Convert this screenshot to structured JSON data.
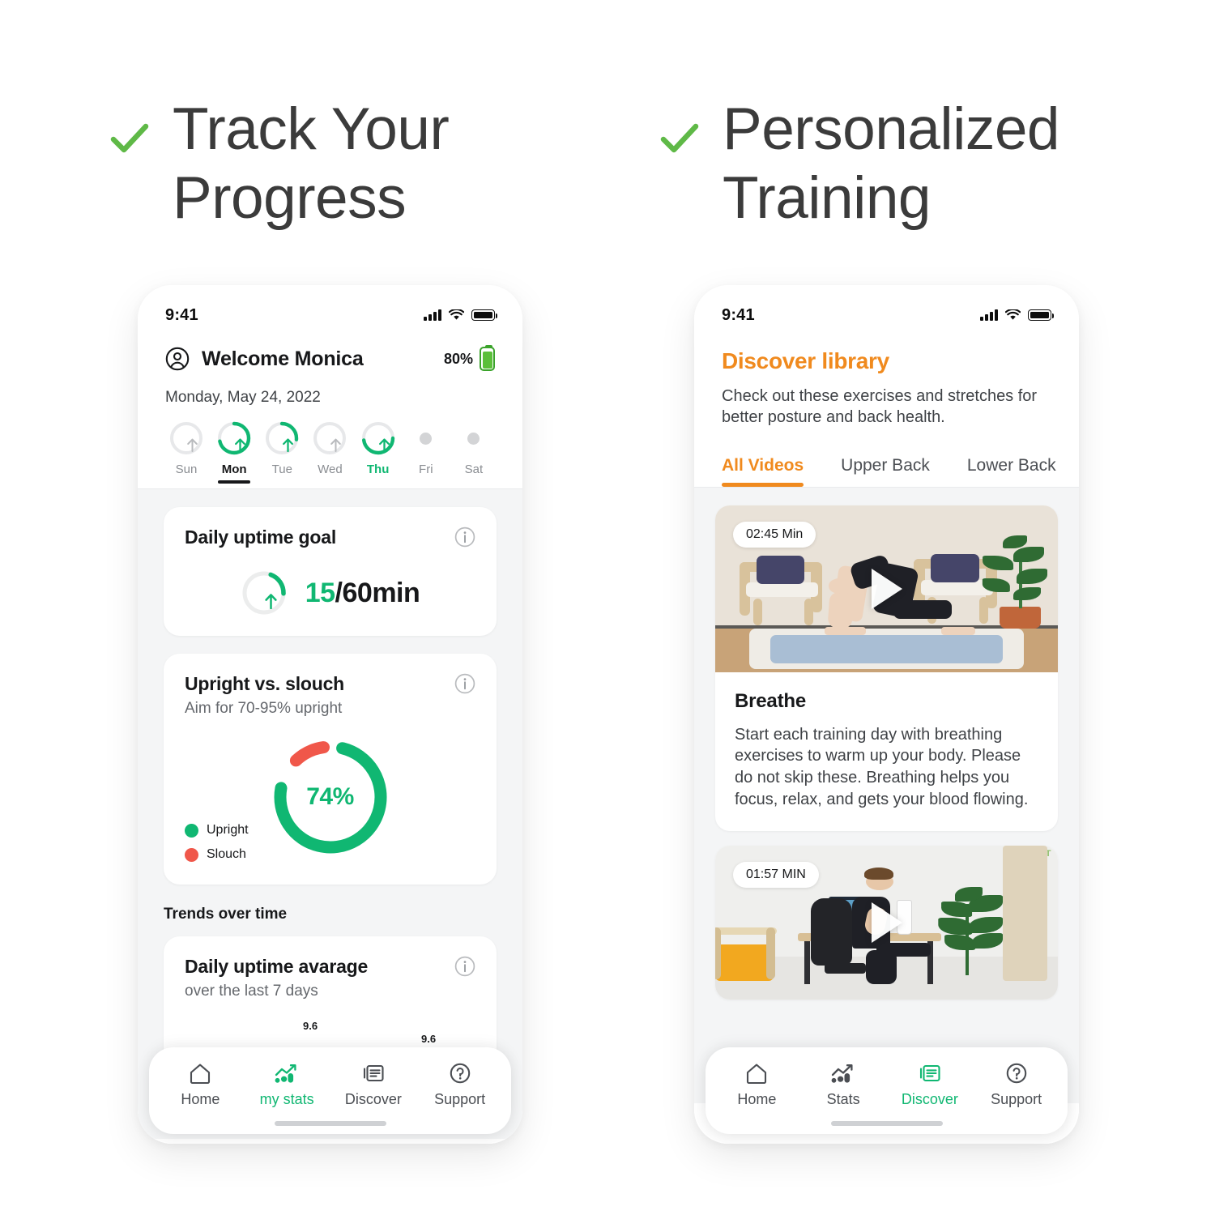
{
  "features": [
    {
      "id": "track-progress",
      "line1": "Track Your",
      "line2": "Progress",
      "check": "check-icon"
    },
    {
      "id": "personalized-training",
      "line1": "Personalized",
      "line2": "Training",
      "check": "check-icon"
    }
  ],
  "colors": {
    "green": "#10b772",
    "green_check": "#5fb947",
    "orange": "#f08a1e",
    "red": "#f0574a",
    "yellow": "#f2b53c",
    "text_dark": "#17181a",
    "text_muted": "#65686d",
    "screen_bg": "#f4f5f6"
  },
  "left_phone": {
    "status": {
      "time": "9:41",
      "signal_icon": "cellular-signal-icon",
      "wifi_icon": "wifi-icon",
      "battery_icon": "battery-icon"
    },
    "header": {
      "avatar_icon": "account-circle-icon",
      "welcome": "Welcome Monica",
      "battery_percent": "80%",
      "battery_icon": "battery-green-icon",
      "date": "Monday, May 24, 2022"
    },
    "week": [
      {
        "label": "Sun",
        "progress": 0,
        "state": "empty",
        "arrow": "grey"
      },
      {
        "label": "Mon",
        "progress": 72,
        "state": "active",
        "arrow": "green"
      },
      {
        "label": "Tue",
        "progress": 27,
        "state": "normal",
        "arrow": "green"
      },
      {
        "label": "Wed",
        "progress": 0,
        "state": "empty",
        "arrow": "grey"
      },
      {
        "label": "Thu",
        "progress": 48,
        "state": "highlight",
        "arrow": "green"
      },
      {
        "label": "Fri",
        "progress": 0,
        "state": "dot",
        "arrow": "none"
      },
      {
        "label": "Sat",
        "progress": 0,
        "state": "dot",
        "arrow": "none"
      }
    ],
    "goal_card": {
      "title": "Daily uptime goal",
      "info_icon": "info-icon",
      "arrow_icon": "arrow-up-icon",
      "value": "15",
      "separator": "/",
      "target": "60min",
      "progress": 25
    },
    "posture_card": {
      "title": "Upright vs. slouch",
      "subtitle": "Aim for 70-95% upright",
      "info_icon": "info-icon",
      "percent": "74%",
      "legend": [
        {
          "label": "Upright",
          "color": "#10b772"
        },
        {
          "label": "Slouch",
          "color": "#f0574a"
        }
      ]
    },
    "trends": {
      "section_title": "Trends over time",
      "card_title": "Daily uptime avarage",
      "card_subtitle": "over the last 7 days",
      "info_icon": "info-icon",
      "bar_labels": [
        "9.6",
        "9.6"
      ]
    },
    "tabs": [
      {
        "label": "Home",
        "icon": "home-icon",
        "active": false
      },
      {
        "label": "my stats",
        "icon": "stats-icon",
        "active": true
      },
      {
        "label": "Discover",
        "icon": "discover-icon",
        "active": false
      },
      {
        "label": "Support",
        "icon": "support-icon",
        "active": false
      }
    ]
  },
  "right_phone": {
    "status": {
      "time": "9:41",
      "signal_icon": "cellular-signal-icon",
      "wifi_icon": "wifi-icon",
      "battery_icon": "battery-icon"
    },
    "header": {
      "title": "Discover library",
      "subtitle": "Check out these exercises and stretches for better posture and back health."
    },
    "video_tabs": [
      {
        "label": "All Videos",
        "active": true
      },
      {
        "label": "Upper Back",
        "active": false
      },
      {
        "label": "Lower Back",
        "active": false
      }
    ],
    "videos": [
      {
        "duration": "02:45 Min",
        "play_icon": "play-icon",
        "title": "Breathe",
        "description": "Start each training day with breathing exercises to warm up your body. Please do not skip these. Breathing helps you focus, relax, and gets your blood flowing."
      },
      {
        "duration": "01:57 MIN",
        "play_icon": "play-icon",
        "title": "",
        "description": ""
      }
    ],
    "tabs": [
      {
        "label": "Home",
        "icon": "home-icon",
        "active": false
      },
      {
        "label": "Stats",
        "icon": "stats-icon",
        "active": false
      },
      {
        "label": "Discover",
        "icon": "discover-icon",
        "active": true
      },
      {
        "label": "Support",
        "icon": "support-icon",
        "active": false
      }
    ]
  }
}
